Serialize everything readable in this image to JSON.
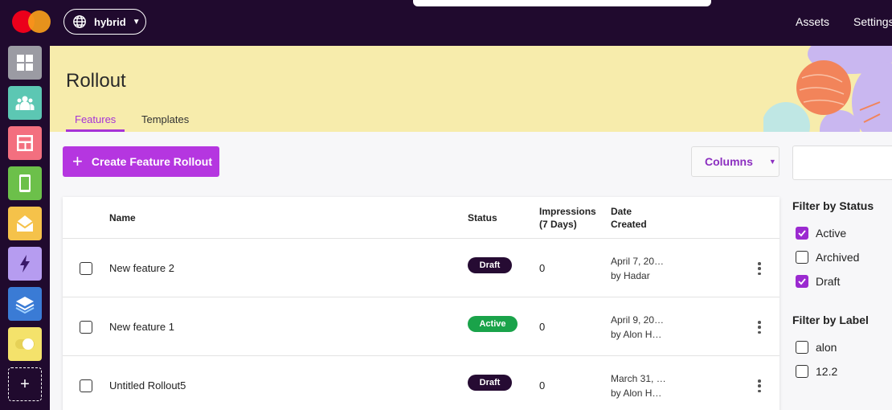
{
  "topbar": {
    "environment": "hybrid",
    "nav": [
      "Assets",
      "Settings"
    ]
  },
  "sidebar": {
    "apps": [
      {
        "icon": "dashboard-grid-icon",
        "color": "#9b9ba3"
      },
      {
        "icon": "people-icon",
        "color": "#5cc7b3"
      },
      {
        "icon": "layout-icon",
        "color": "#f36f7f"
      },
      {
        "icon": "mobile-icon",
        "color": "#6cc04a"
      },
      {
        "icon": "envelope-icon",
        "color": "#f5c24a"
      },
      {
        "icon": "lightning-icon",
        "color": "#b69cf0"
      },
      {
        "icon": "layers-icon",
        "color": "#3a7bd5"
      },
      {
        "icon": "toggle-icon",
        "color": "#f4e26b"
      }
    ],
    "add_label": "+"
  },
  "header": {
    "title": "Rollout",
    "tabs": [
      {
        "label": "Features",
        "active": true
      },
      {
        "label": "Templates",
        "active": false
      }
    ]
  },
  "toolbar": {
    "create_label": "Create Feature Rollout",
    "columns_label": "Columns"
  },
  "table": {
    "headers": {
      "name": "Name",
      "status": "Status",
      "impressions_line1": "Impressions",
      "impressions_line2": "(7 Days)",
      "date_line1": "Date",
      "date_line2": "Created"
    },
    "rows": [
      {
        "name": "New feature 2",
        "status": "Draft",
        "impressions": "0",
        "date": "April 7, 20…",
        "by": "by Hadar"
      },
      {
        "name": "New feature 1",
        "status": "Active",
        "impressions": "0",
        "date": "April 9, 20…",
        "by": "by Alon H…"
      },
      {
        "name": "Untitled Rollout5",
        "status": "Draft",
        "impressions": "0",
        "date": "March 31, …",
        "by": "by Alon H…"
      }
    ]
  },
  "filters": {
    "status_title": "Filter by Status",
    "status_options": [
      {
        "label": "Active",
        "checked": true
      },
      {
        "label": "Archived",
        "checked": false
      },
      {
        "label": "Draft",
        "checked": true
      }
    ],
    "label_title": "Filter by Label",
    "label_options": [
      {
        "label": "alon",
        "checked": false
      },
      {
        "label": "12.2",
        "checked": false
      }
    ]
  },
  "colors": {
    "topbar": "#200a2e",
    "accent": "#b536e0",
    "header_band": "#f7ecac",
    "draft_badge": "#260b33",
    "active_badge": "#1aa34a"
  }
}
